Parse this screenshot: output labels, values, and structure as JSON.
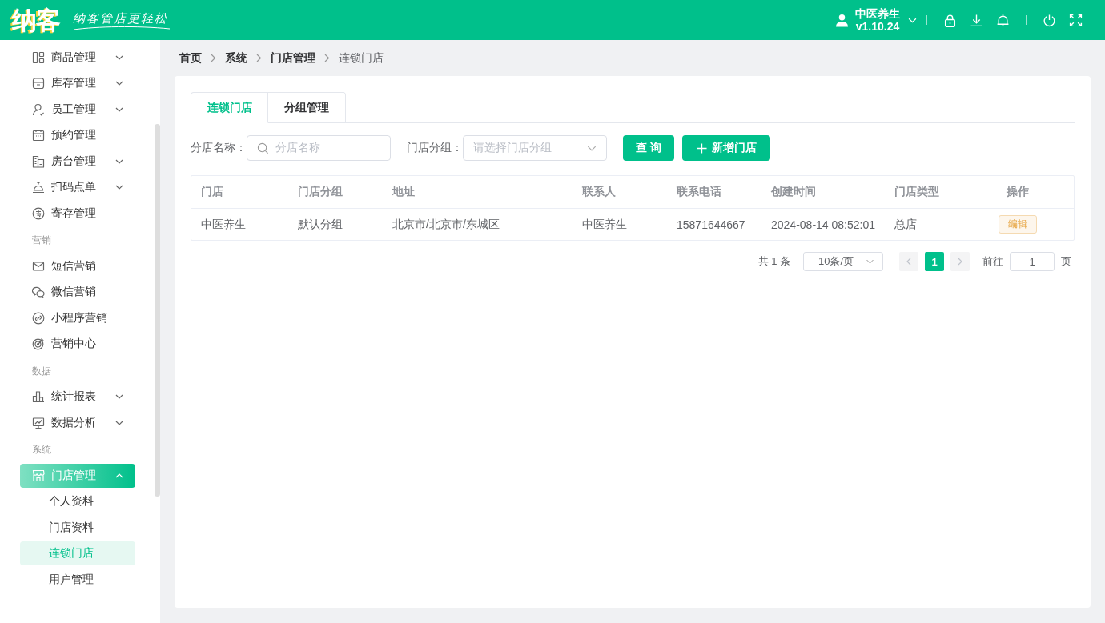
{
  "header": {
    "logo": "纳客",
    "slogan": "纳客管店更轻松",
    "user": {
      "name": "中医养生",
      "version": "v1.10.24"
    }
  },
  "sidebar": {
    "sections": [
      {
        "items": [
          {
            "label": "商品管理",
            "expandable": true,
            "expanded": false,
            "selected": false
          },
          {
            "label": "库存管理",
            "expandable": true,
            "expanded": false,
            "selected": false
          },
          {
            "label": "员工管理",
            "expandable": true,
            "expanded": false,
            "selected": false
          },
          {
            "label": "预约管理",
            "expandable": false,
            "selected": false
          },
          {
            "label": "房台管理",
            "expandable": true,
            "expanded": false,
            "selected": false
          },
          {
            "label": "扫码点单",
            "expandable": true,
            "expanded": false,
            "selected": false
          },
          {
            "label": "寄存管理",
            "expandable": false,
            "selected": false
          }
        ]
      },
      {
        "title": "营销",
        "items": [
          {
            "label": "短信营销",
            "expandable": false,
            "selected": false
          },
          {
            "label": "微信营销",
            "expandable": false,
            "selected": false
          },
          {
            "label": "小程序营销",
            "expandable": false,
            "selected": false
          },
          {
            "label": "营销中心",
            "expandable": false,
            "selected": false
          }
        ]
      },
      {
        "title": "数据",
        "items": [
          {
            "label": "统计报表",
            "expandable": true,
            "expanded": false,
            "selected": false
          },
          {
            "label": "数据分析",
            "expandable": true,
            "expanded": false,
            "selected": false
          }
        ]
      },
      {
        "title": "系统",
        "items": [
          {
            "label": "门店管理",
            "expandable": true,
            "expanded": true,
            "selected": true,
            "children": [
              {
                "label": "个人资料",
                "selected": false
              },
              {
                "label": "门店资料",
                "selected": false
              },
              {
                "label": "连锁门店",
                "selected": true
              },
              {
                "label": "用户管理",
                "selected": false
              }
            ]
          }
        ]
      }
    ]
  },
  "breadcrumb": [
    {
      "label": "首页",
      "current": false
    },
    {
      "label": "系统",
      "current": false
    },
    {
      "label": "门店管理",
      "current": false
    },
    {
      "label": "连锁门店",
      "current": true
    }
  ],
  "tabs": [
    {
      "label": "连锁门店",
      "selected": true
    },
    {
      "label": "分组管理",
      "selected": false
    }
  ],
  "filters": [
    {
      "kind": "search",
      "label": "分店名称：",
      "placeholder": "分店名称"
    },
    {
      "kind": "select",
      "label": "门店分组：",
      "placeholder": "请选择门店分组"
    }
  ],
  "buttons": [
    {
      "kind": "query",
      "label": "查 询"
    },
    {
      "kind": "add",
      "label": "新增门店"
    }
  ],
  "table": {
    "columns": [
      "门店",
      "门店分组",
      "地址",
      "联系人",
      "联系电话",
      "创建时间",
      "门店类型",
      "操作"
    ],
    "rows": [
      {
        "cells": [
          "中医养生",
          "默认分组",
          "北京市/北京市/东城区",
          "中医养生",
          "15871644667",
          "2024-08-14 08:52:01",
          "总店"
        ],
        "action": "编辑"
      }
    ]
  },
  "pagination": {
    "total": "共 1 条",
    "page_size": "10条/页",
    "prev": {
      "disabled": true
    },
    "pages": [
      {
        "label": "1",
        "selected": true
      }
    ],
    "next": {
      "disabled": true
    },
    "goto_label": "前往",
    "goto_value": "1",
    "goto_suffix": "页"
  }
}
